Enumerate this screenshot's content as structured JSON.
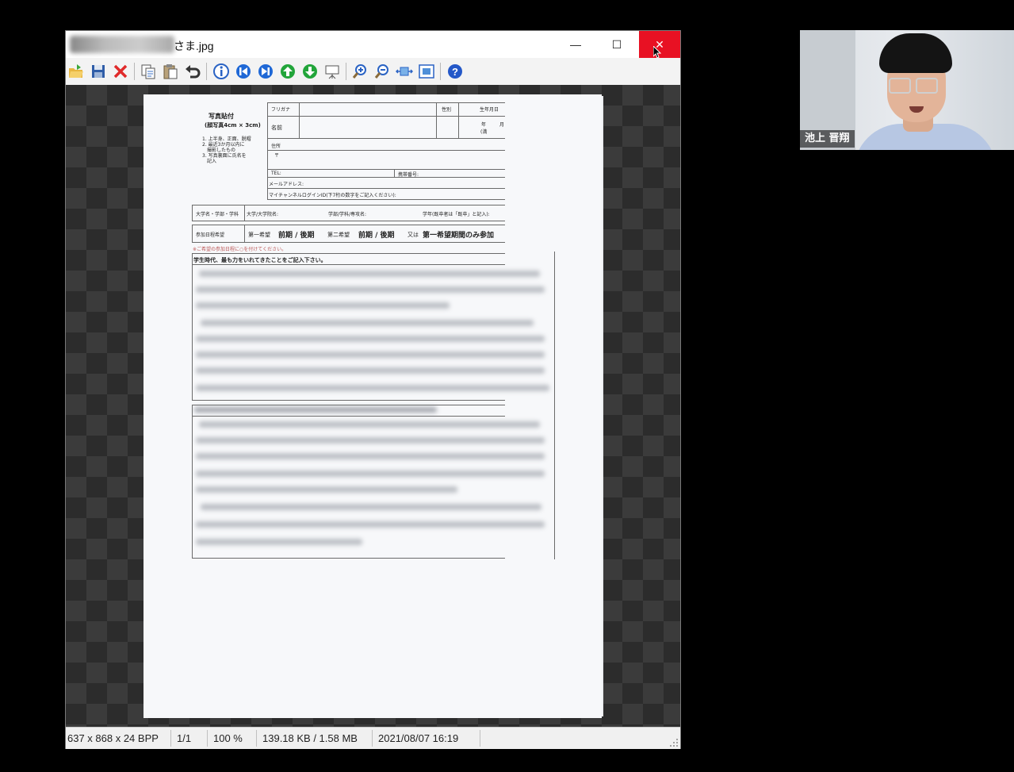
{
  "viewer": {
    "title": "さま.jpg",
    "controls": {
      "minimize": "—",
      "maximize": "☐",
      "close": "✕"
    },
    "toolbar": [
      "open-icon",
      "save-icon",
      "delete-icon",
      "copy-icon",
      "paste-icon",
      "undo-icon",
      "info-icon",
      "first-icon",
      "last-icon",
      "up-icon",
      "down-icon",
      "slideshow-icon",
      "zoom-in-icon",
      "zoom-out-icon",
      "fit-width-icon",
      "fit-window-icon",
      "help-icon"
    ],
    "status": {
      "dimensions": "637 x 868 x 24 BPP",
      "page": "1/1",
      "zoom": "100 %",
      "size": "139.18 KB / 1.58 MB",
      "datetime": "2021/08/07 16:19"
    }
  },
  "document": {
    "photo": {
      "title": "写真貼付",
      "subtitle": "(顔写真4cm × 3cm)",
      "notes": [
        "1. 上半身、正面、脱帽",
        "2. 最近3か月以内に",
        "撮影したもの",
        "3. 写真裏面に氏名を",
        "記入"
      ]
    },
    "fields": {
      "furigana": "フリガナ",
      "gender": "性別",
      "birth": "生年月日",
      "name": "名前",
      "year": "年",
      "month": "月",
      "age": "(満",
      "address": "住所",
      "postal": "〒",
      "tel": "TEL:",
      "mobile": "携帯番号:",
      "email": "メールアドレス:",
      "mynavi": "マイチャンネルログインID(下7桁の数字をご記入ください):"
    },
    "school": {
      "label": "大学名・学部・学科",
      "university": "大学/大学院名:",
      "faculty": "学部/学科/専攻名:",
      "grade": "学年(既卒者は「既卒」と記入):"
    },
    "participation": {
      "label": "参加日程希望",
      "first_choice": "第一希望",
      "first_value": "前期 / 後期",
      "second_choice": "第二希望",
      "second_value": "前期 / 後期",
      "or": "又は",
      "only": "第一希望期間のみ参加",
      "note": "※ご希望の参加日程に○を付けてください。"
    },
    "question1": "学生時代、最も力をいれてきたことをご記入下さい。"
  },
  "participant": {
    "name": "池上 晋翔"
  }
}
